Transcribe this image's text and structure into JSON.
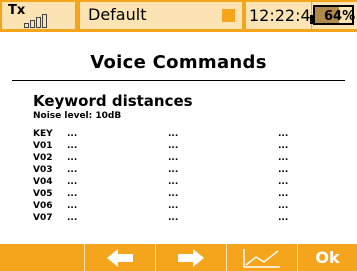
{
  "status": {
    "tx_label": "Tx",
    "model_name": "Default",
    "clock": "12:22:48",
    "battery": {
      "text": "64%",
      "level": 0.64
    }
  },
  "title": "Voice Commands",
  "section": {
    "heading": "Keyword distances",
    "noise_level": "Noise level: 10dB"
  },
  "table": {
    "rows": [
      {
        "key": "KEY",
        "c1": "...",
        "c2": "...",
        "c3": "..."
      },
      {
        "key": "V01",
        "c1": "...",
        "c2": "...",
        "c3": "..."
      },
      {
        "key": "V02",
        "c1": "...",
        "c2": "...",
        "c3": "..."
      },
      {
        "key": "V03",
        "c1": "...",
        "c2": "...",
        "c3": "..."
      },
      {
        "key": "V04",
        "c1": "...",
        "c2": "...",
        "c3": "..."
      },
      {
        "key": "V05",
        "c1": "...",
        "c2": "...",
        "c3": "..."
      },
      {
        "key": "V06",
        "c1": "...",
        "c2": "...",
        "c3": "..."
      },
      {
        "key": "V07",
        "c1": "...",
        "c2": "...",
        "c3": "..."
      }
    ]
  },
  "buttons": {
    "b1_icon": "blank",
    "b2_icon": "arrow-left-icon",
    "b3_icon": "arrow-right-icon",
    "b4_icon": "chart-icon",
    "ok_label": "Ok"
  },
  "colors": {
    "accent": "#f4a51c",
    "light": "#fbe3b3"
  }
}
